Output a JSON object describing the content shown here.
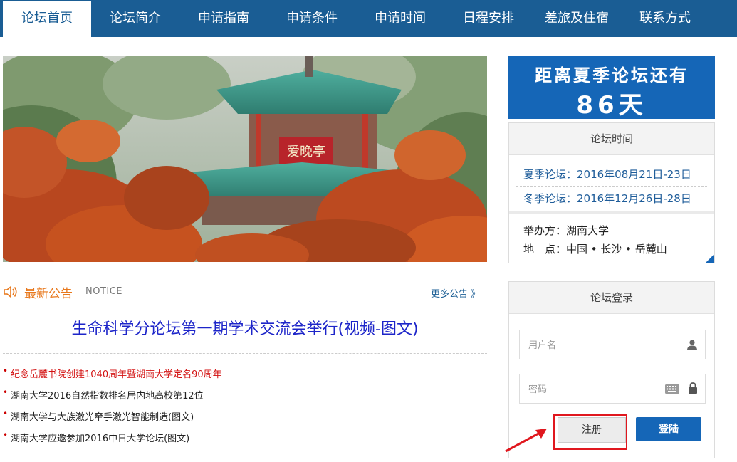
{
  "nav": {
    "items": [
      {
        "label": "论坛首页",
        "active": true
      },
      {
        "label": "论坛简介"
      },
      {
        "label": "申请指南"
      },
      {
        "label": "申请条件"
      },
      {
        "label": "申请时间"
      },
      {
        "label": "日程安排"
      },
      {
        "label": "差旅及住宿"
      },
      {
        "label": "联系方式"
      }
    ]
  },
  "banner": {
    "sign_text": "爱晚亭",
    "slide_count": 10,
    "active_slide": 6
  },
  "notice": {
    "title": "最新公告",
    "title_en": "NOTICE",
    "more": "更多公告 》",
    "headline": "生命科学分论坛第一期学术交流会举行(视频-图文)",
    "items": [
      {
        "text": "纪念岳麓书院创建1040周年暨湖南大学定名90周年",
        "highlight": true
      },
      {
        "text": "湖南大学2016自然指数排名居内地高校第12位"
      },
      {
        "text": "湖南大学与大族激光牵手激光智能制造(图文)"
      },
      {
        "text": "湖南大学应邀参加2016中日大学论坛(图文)"
      }
    ]
  },
  "countdown": {
    "line1": "距离夏季论坛还有",
    "line2": "86天"
  },
  "forum_time": {
    "title": "论坛时间",
    "summer": "夏季论坛：2016年08月21日-23日",
    "winter": "冬季论坛：2016年12月26日-28日",
    "organizer": "举办方：湖南大学",
    "location": "地　点：中国 • 长沙 • 岳麓山"
  },
  "login": {
    "title": "论坛登录",
    "username_placeholder": "用户名",
    "password_placeholder": "密码",
    "register_label": "注册",
    "login_label": "登陆"
  },
  "colors": {
    "nav_bg": "#1a5d94",
    "accent_blue": "#1566b7",
    "notice_orange": "#e8781c",
    "headline_blue": "#1d25c9",
    "highlight_red": "#d31111"
  }
}
